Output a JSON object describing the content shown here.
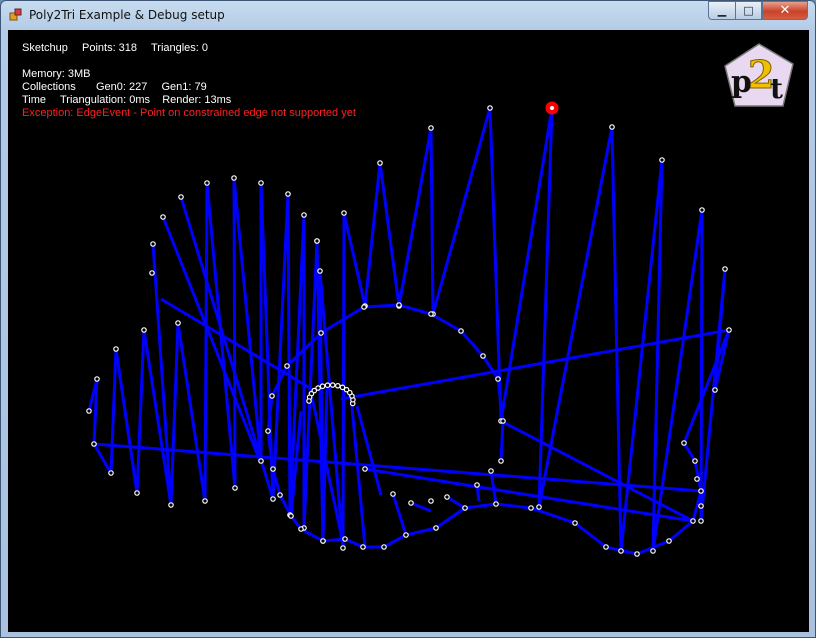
{
  "window": {
    "title": "Poly2Tri Example & Debug setup"
  },
  "stats": {
    "mode": "Sketchup",
    "points": "Points: 318",
    "triangles": "Triangles: 0",
    "memory": "Memory: 3MB",
    "collections_label": "Collections",
    "gen0": "Gen0: 227",
    "gen1": "Gen1: 79",
    "time_label": "Time",
    "triangulation": "Triangulation: 0ms",
    "render": "Render: 13ms",
    "exception": "Exception: EdgeEvent - Point on constrained edge not supported yet"
  },
  "logo": {
    "text_p": "p",
    "text_2": "2",
    "text_t": "t"
  },
  "colors": {
    "edge": "#0000ff",
    "point": "#ffffff",
    "highlight": "#ff0000",
    "error_text": "#ff2020"
  }
}
